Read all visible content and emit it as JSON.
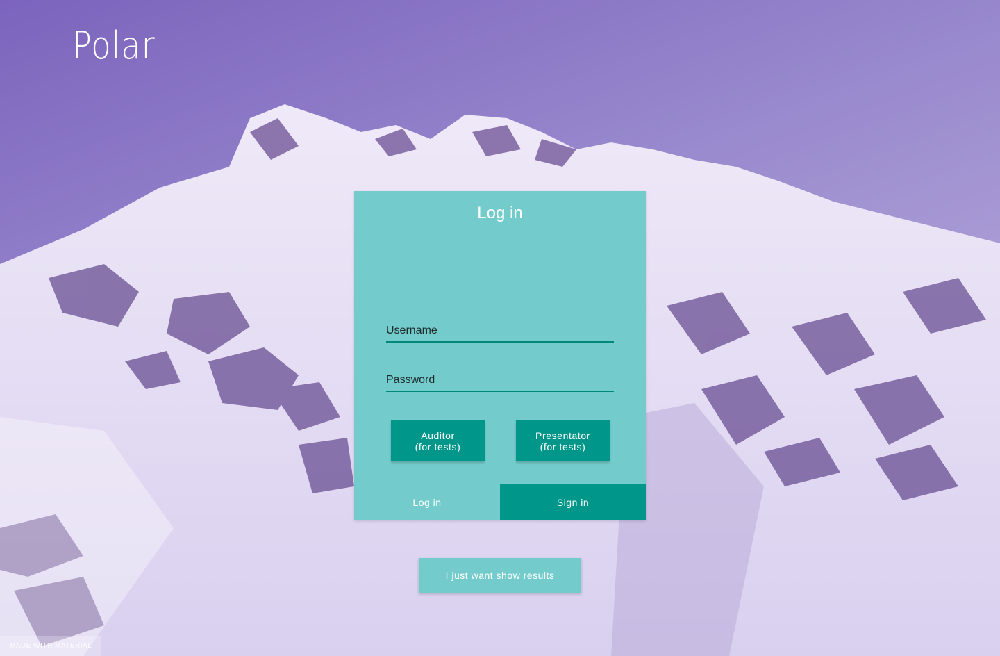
{
  "brand": {
    "title": "Polar"
  },
  "login_card": {
    "title": "Log in",
    "username": {
      "label": "Username",
      "value": ""
    },
    "password": {
      "label": "Password",
      "value": ""
    },
    "role_buttons": {
      "auditor": "Auditor\n(for tests)",
      "presentator": "Presentator\n(for tests)"
    },
    "tabs": {
      "login": "Log in",
      "signin": "Sign in",
      "active": "signin"
    }
  },
  "results_button": "I just want show results",
  "footer": {
    "made_with": "MADE WITH MATERIAL"
  },
  "colors": {
    "card": "#73cbcc",
    "accent": "#00978a",
    "background": "#8a74c6"
  }
}
